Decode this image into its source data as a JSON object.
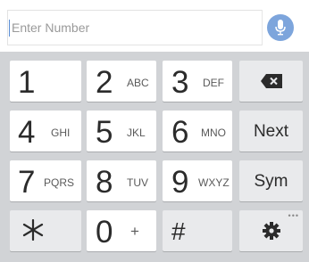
{
  "input": {
    "placeholder": "Enter Number",
    "mic_icon": "microphone-icon"
  },
  "keys": {
    "k1": {
      "digit": "1",
      "letters": ""
    },
    "k2": {
      "digit": "2",
      "letters": "ABC"
    },
    "k3": {
      "digit": "3",
      "letters": "DEF"
    },
    "k4": {
      "digit": "4",
      "letters": "GHI"
    },
    "k5": {
      "digit": "5",
      "letters": "JKL"
    },
    "k6": {
      "digit": "6",
      "letters": "MNO"
    },
    "k7": {
      "digit": "7",
      "letters": "PQRS"
    },
    "k8": {
      "digit": "8",
      "letters": "TUV"
    },
    "k9": {
      "digit": "9",
      "letters": "WXYZ"
    },
    "k0": {
      "digit": "0",
      "letters": "+"
    },
    "star": {
      "symbol": "∗"
    },
    "hash": {
      "symbol": "#"
    }
  },
  "side_keys": {
    "backspace_icon": "backspace-icon",
    "next_label": "Next",
    "sym_label": "Sym",
    "settings_icon": "gear-icon",
    "more_indicator": "•••"
  },
  "colors": {
    "keypad_bg": "#d1d3d6",
    "key_bg": "#ffffff",
    "function_key_bg": "#e9eaec",
    "mic_accent": "#7da5dc",
    "caret": "#5b8fd6"
  }
}
